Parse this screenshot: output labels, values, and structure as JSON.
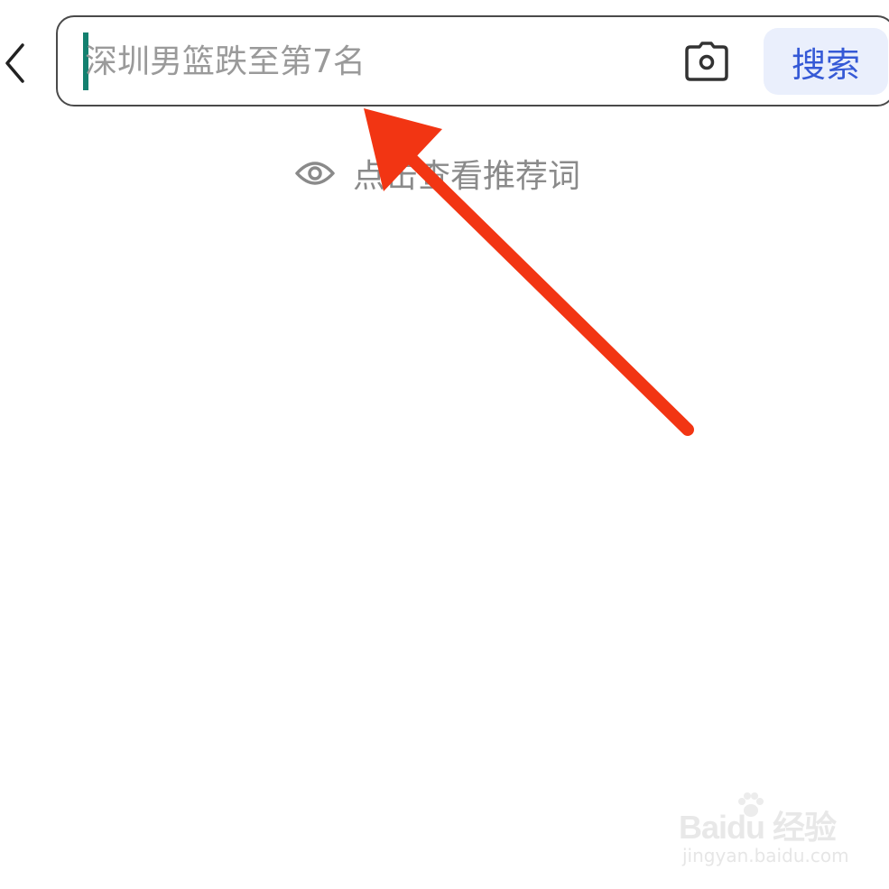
{
  "search": {
    "placeholder": "深圳男篮跌至第7名",
    "value": "",
    "button_label": "搜索"
  },
  "recommend": {
    "label": "点击查看推荐词"
  },
  "icons": {
    "back": "chevron-left-icon",
    "camera": "camera-icon",
    "eye": "eye-icon"
  },
  "colors": {
    "cursor": "#13806f",
    "search_button_bg": "#eaeffc",
    "search_button_text": "#3559d6",
    "annotation_arrow": "#f23513"
  },
  "watermark": {
    "logo_text": "Baidu 经验",
    "url": "jingyan.baidu.com"
  }
}
